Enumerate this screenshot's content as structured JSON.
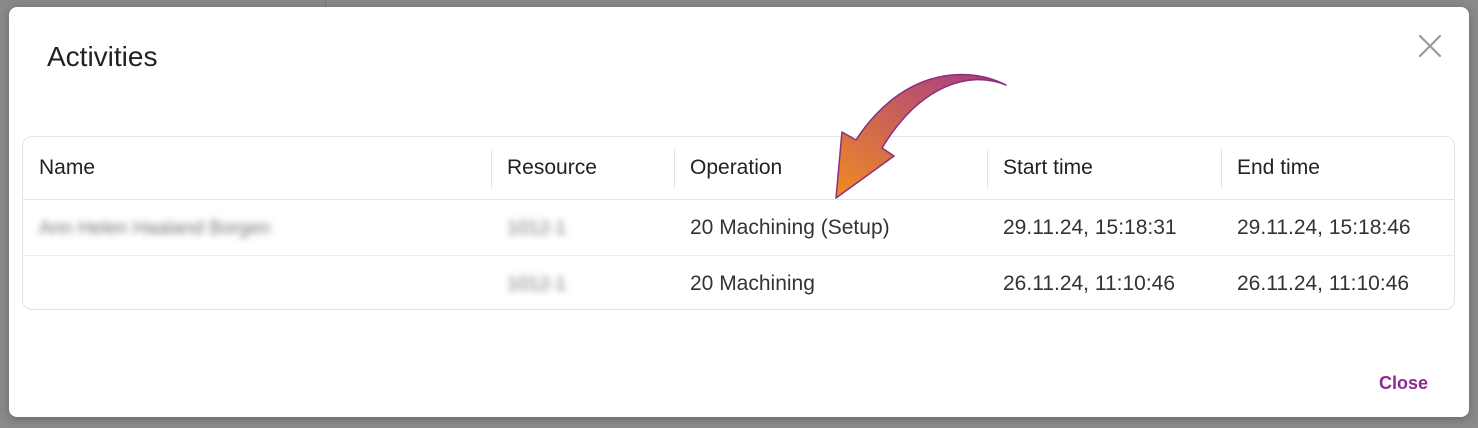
{
  "dialog": {
    "title": "Activities",
    "close_label": "Close"
  },
  "table": {
    "columns": [
      "Name",
      "Resource",
      "Operation",
      "Start time",
      "End time"
    ],
    "rows": [
      {
        "name": "Ann Helen Haaland Borgen",
        "resource": "1012-1",
        "operation": "20 Machining (Setup)",
        "start": "29.11.24, 15:18:31",
        "end": "29.11.24, 15:18:46"
      },
      {
        "name": "",
        "resource": "1012-1",
        "operation": "20 Machining",
        "start": "26.11.24, 11:10:46",
        "end": "26.11.24, 11:10:46"
      }
    ]
  },
  "colors": {
    "accent": "#8e2a8e",
    "arrow_start": "#f08a24",
    "arrow_end": "#a23a8a"
  },
  "icons": {
    "close": "close-icon",
    "annotation": "curved-arrow-icon"
  }
}
